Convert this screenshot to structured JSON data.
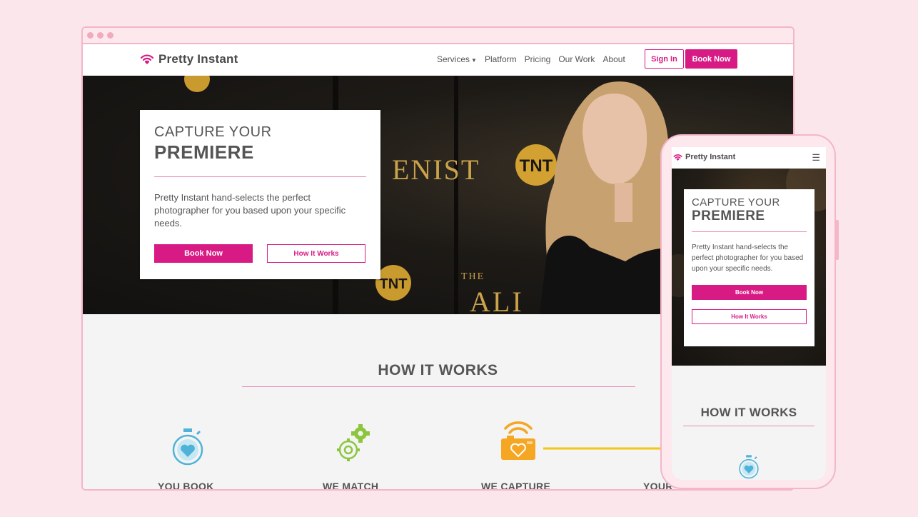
{
  "brand": {
    "name": "Pretty Instant",
    "accent": "#d81b84",
    "background": "#fbe6ec",
    "frame": "#f4b6c9"
  },
  "nav": {
    "items": [
      {
        "label": "Services",
        "has_dropdown": true
      },
      {
        "label": "Platform"
      },
      {
        "label": "Pricing"
      },
      {
        "label": "Our Work"
      },
      {
        "label": "About"
      }
    ],
    "sign_in": "Sign In",
    "book_now": "Book Now"
  },
  "hero": {
    "headline_line1": "CAPTURE YOUR",
    "headline_line2": "PREMIERE",
    "description": "Pretty Instant hand-selects the perfect photographer for you based upon your specific needs.",
    "primary_button": "Book Now",
    "secondary_button": "How It Works",
    "backdrop_text": [
      "ENIST",
      "TNT",
      "THE",
      "ALI"
    ]
  },
  "how_it_works": {
    "title": "HOW IT WORKS",
    "steps": [
      {
        "label": "YOU BOOK",
        "icon": "stopwatch-heart-icon",
        "color": "#4fb3d9"
      },
      {
        "label": "WE MATCH",
        "icon": "gears-icon",
        "color": "#8cc63f"
      },
      {
        "label": "WE CAPTURE",
        "icon": "camera-wifi-icon",
        "color": "#f5a623"
      },
      {
        "label": "YOUR",
        "icon": "delivery-icon",
        "color": "#f5c518"
      }
    ]
  },
  "mobile": {
    "brand": "Pretty Instant",
    "menu_icon": "hamburger-icon",
    "headline_line1": "CAPTURE YOUR",
    "headline_line2": "PREMIERE",
    "description": "Pretty Instant hand-selects the perfect photographer for you based upon your specific needs.",
    "primary_button": "Book Now",
    "secondary_button": "How It Works",
    "how_title": "HOW IT WORKS"
  }
}
